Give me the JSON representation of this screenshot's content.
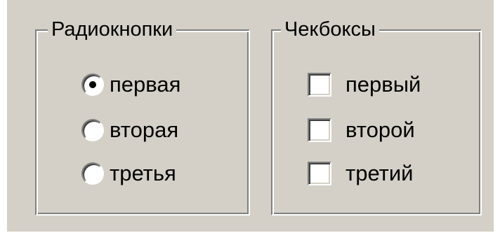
{
  "radio_group": {
    "title": "Радиокнопки",
    "items": [
      {
        "label": "первая",
        "checked": true
      },
      {
        "label": "вторая",
        "checked": false
      },
      {
        "label": "третья",
        "checked": false
      }
    ]
  },
  "checkbox_group": {
    "title": "Чекбоксы",
    "items": [
      {
        "label": "первый",
        "checked": false
      },
      {
        "label": "второй",
        "checked": false
      },
      {
        "label": "третий",
        "checked": false
      }
    ]
  },
  "colors": {
    "face": "#d4d0c8",
    "shadow": "#808080",
    "highlight": "#ffffff"
  }
}
